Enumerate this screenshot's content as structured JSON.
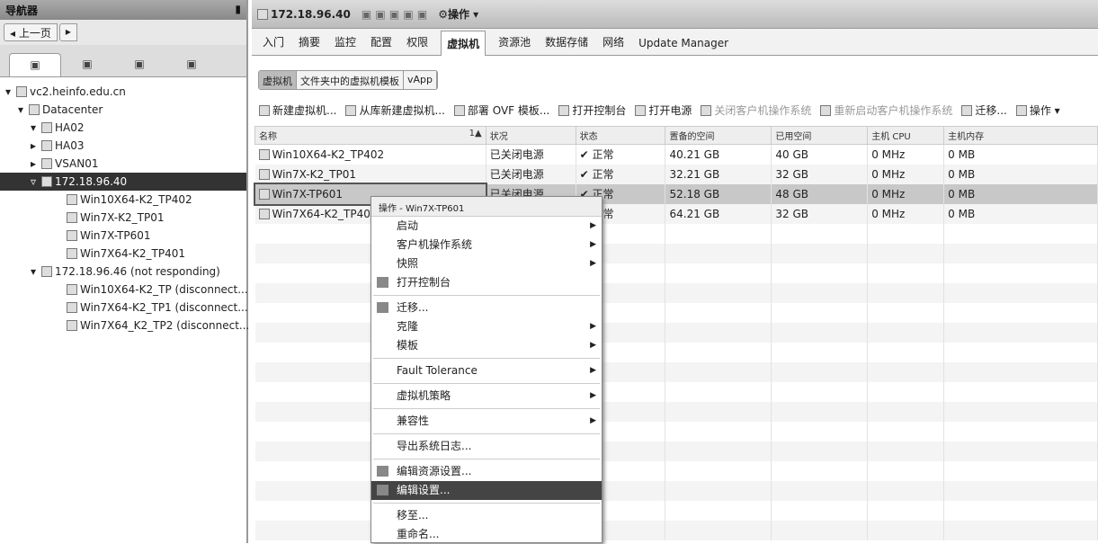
{
  "navigator": {
    "title": "导航器",
    "pin_icon": "pin-icon",
    "back": "上一页",
    "tabs": [
      "hosts-clusters-icon",
      "vms-templates-icon",
      "storage-icon",
      "network-icon"
    ],
    "tree": [
      {
        "label": "vc2.heinfo.edu.cn",
        "level": 0,
        "toggle": "▾"
      },
      {
        "label": "Datacenter",
        "level": 1,
        "toggle": "▾"
      },
      {
        "label": "HA02",
        "level": 2,
        "toggle": "▾"
      },
      {
        "label": "HA03",
        "level": 2,
        "toggle": "▸"
      },
      {
        "label": "VSAN01",
        "level": 2,
        "toggle": "▸"
      },
      {
        "label": "172.18.96.40",
        "level": 2,
        "toggle": "▿",
        "selected": true
      },
      {
        "label": "Win10X64-K2_TP402",
        "level": 4,
        "toggle": ""
      },
      {
        "label": "Win7X-K2_TP01",
        "level": 4,
        "toggle": ""
      },
      {
        "label": "Win7X-TP601",
        "level": 4,
        "toggle": ""
      },
      {
        "label": "Win7X64-K2_TP401",
        "level": 4,
        "toggle": ""
      },
      {
        "label": "172.18.96.46 (not responding)",
        "level": 2,
        "toggle": "▾"
      },
      {
        "label": "Win10X64-K2_TP (disconnect...",
        "level": 4,
        "toggle": ""
      },
      {
        "label": "Win7X64-K2_TP1 (disconnect...",
        "level": 4,
        "toggle": ""
      },
      {
        "label": "Win7X64_K2_TP2 (disconnect...",
        "level": 4,
        "toggle": ""
      }
    ]
  },
  "header": {
    "host": "172.18.96.40",
    "actions": "操作 ▾"
  },
  "tabs": [
    "入门",
    "摘要",
    "监控",
    "配置",
    "权限",
    "虚拟机",
    "资源池",
    "数据存储",
    "网络",
    "Update Manager"
  ],
  "active_tab": "虚拟机",
  "subtabs": [
    "虚拟机",
    "文件夹中的虚拟机模板",
    "vApp"
  ],
  "toolbar": [
    {
      "label": "新建虚拟机...",
      "enabled": true
    },
    {
      "label": "从库新建虚拟机...",
      "enabled": true
    },
    {
      "label": "部署 OVF 模板...",
      "enabled": true
    },
    {
      "label": "打开控制台",
      "enabled": true
    },
    {
      "label": "打开电源",
      "enabled": true
    },
    {
      "label": "关闭客户机操作系统",
      "enabled": false
    },
    {
      "label": "重新启动客户机操作系统",
      "enabled": false
    },
    {
      "label": "迁移...",
      "enabled": true
    },
    {
      "label": "操作 ▾",
      "enabled": true
    }
  ],
  "table": {
    "columns": [
      "名称",
      "状况",
      "状态",
      "置备的空间",
      "已用空间",
      "主机 CPU",
      "主机内存"
    ],
    "sort": "1▲",
    "rows": [
      [
        "Win10X64-K2_TP402",
        "已关闭电源",
        "正常",
        "40.21 GB",
        "40 GB",
        "0 MHz",
        "0 MB"
      ],
      [
        "Win7X-K2_TP01",
        "已关闭电源",
        "正常",
        "32.21 GB",
        "32 GB",
        "0 MHz",
        "0 MB"
      ],
      [
        "Win7X-TP601",
        "已关闭电源",
        "正常",
        "52.18 GB",
        "48 GB",
        "0 MHz",
        "0 MB"
      ],
      [
        "Win7X64-K2_TP401",
        "已关闭电源",
        "正常",
        "64.21 GB",
        "32 GB",
        "0 MHz",
        "0 MB"
      ]
    ],
    "selected_row": 2
  },
  "context_menu": {
    "title": "操作 - Win7X-TP601",
    "items": [
      {
        "label": "启动",
        "sub": true
      },
      {
        "label": "客户机操作系统",
        "sub": true
      },
      {
        "label": "快照",
        "sub": true
      },
      {
        "label": "打开控制台",
        "icon": "console-icon"
      },
      {
        "sep": true
      },
      {
        "label": "迁移...",
        "icon": "migrate-icon"
      },
      {
        "label": "克隆",
        "sub": true
      },
      {
        "label": "模板",
        "sub": true
      },
      {
        "sep": true
      },
      {
        "label": "Fault Tolerance",
        "sub": true
      },
      {
        "sep": true
      },
      {
        "label": "虚拟机策略",
        "sub": true
      },
      {
        "sep": true
      },
      {
        "label": "兼容性",
        "sub": true
      },
      {
        "sep": true
      },
      {
        "label": "导出系统日志..."
      },
      {
        "sep": true
      },
      {
        "label": "编辑资源设置...",
        "icon": "resource-settings-icon"
      },
      {
        "label": "编辑设置...",
        "icon": "edit-settings-icon",
        "highlight": true
      },
      {
        "sep": true
      },
      {
        "label": "移至..."
      },
      {
        "label": "重命名..."
      }
    ]
  }
}
